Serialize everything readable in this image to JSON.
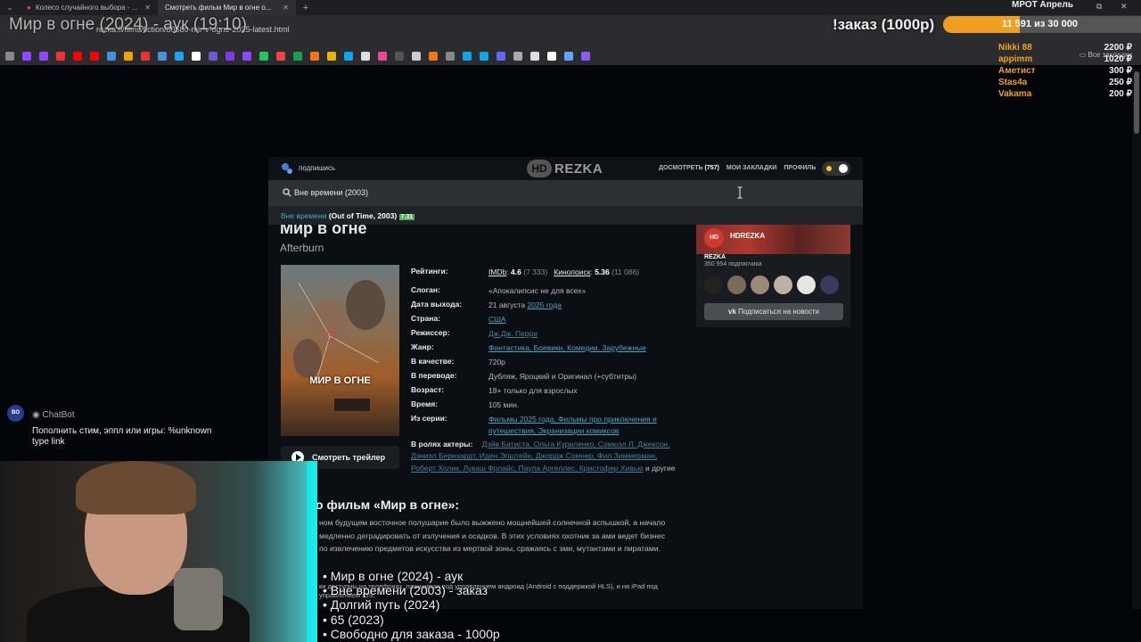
{
  "browser": {
    "tabs": [
      {
        "label": "Колесо случайного выбора - ...",
        "active": false
      },
      {
        "label": "Смотреть фильм Мир в огне о...",
        "active": true
      }
    ],
    "url": "rezka.fi/films/fiction/80680-mir-v-ogne-2025-latest.html",
    "all_bookmarks": "Все закладки"
  },
  "stream_overlay": {
    "title": "Мир в огне (2024) - аук (19:10)",
    "order_banner": "!заказ (1000р)",
    "goal_title": "МРОТ Апрель",
    "goal_progress_text": "11 591  из 30 000",
    "goal_fraction": 0.386,
    "donors": [
      {
        "name": "Nikki 88",
        "amount": "2200 ₽"
      },
      {
        "name": "appimm",
        "amount": "1020 ₽"
      },
      {
        "name": "Аметист",
        "amount": "300 ₽"
      },
      {
        "name": "Stas4a",
        "amount": "250 ₽"
      },
      {
        "name": "Vakama",
        "amount": "200 ₽"
      }
    ],
    "chatbot": {
      "name": "ChatBot",
      "message": "Пополнить стим, эппл или игры:  %unknown type link"
    },
    "queue": [
      "• Мир в огне (2024) - аук",
      "• Вне времени (2003) - заказ",
      "• Долгий путь (2024)",
      "• 65 (2023)",
      "• Свободно для заказа - 1000р"
    ]
  },
  "site": {
    "subscribe_label": "подпишись",
    "logo_hd": "HD",
    "logo_text": "REZKA",
    "nav": {
      "continue": "ДОСМОТРЕТЬ",
      "continue_count": "(757)",
      "bookmarks": "МОИ ЗАКЛАДКИ",
      "profile": "ПРОФИЛЬ"
    },
    "search_value": "Вне времени (2003)",
    "suggestion": {
      "title": "Вне времени",
      "orig": "(Out of Time, 2003)",
      "rating": "7.31"
    }
  },
  "film": {
    "title": "Мир в огне",
    "orig_title": "Afterburn",
    "poster_title": "МИР В ОГНЕ",
    "trailer_label": "Смотреть трейлер",
    "ratings_key": "Рейтинги:",
    "imdb_name": "IMDb",
    "imdb_value": "4.6",
    "imdb_count": "(7 333)",
    "kp_name": "Кинопоиск",
    "kp_value": "5.36",
    "kp_count": "(11 086)",
    "rows": [
      {
        "key": "Слоган:",
        "value": "«Апокалипсис не для всех»"
      },
      {
        "key": "Дата выхода:",
        "value": "21 августа",
        "link": "2025 года"
      },
      {
        "key": "Страна:",
        "link": "США"
      },
      {
        "key": "Режиссер:",
        "link": "Дж.Дж. Перри"
      },
      {
        "key": "Жанр:",
        "link": "Фантастика, Боевики, Комедии, Зарубежные"
      },
      {
        "key": "В качестве:",
        "value": "720p"
      },
      {
        "key": "В переводе:",
        "value": "Дубляж, Ярoцкий и Оригинал (+субтитры)"
      },
      {
        "key": "Возраст:",
        "value": "18+ только для взрослых"
      },
      {
        "key": "Время:",
        "value": "105 мин."
      },
      {
        "key": "Из серии:",
        "link": "Фильмы 2025 года, Фильмы про приключения и путешествия, Экранизации комиксов"
      }
    ],
    "actors_key": "В ролях актеры:",
    "actors": "Дэйв Батиста, Ольга Куриленко, Сэмюэл Л. Джексон, Дэниэл Бернхардт, Иден Эпштейн, Джордж Сомнер, Фил Зиммерман, Роберт Холик, Лукаш Фрлайс, Паула Аргеллес, Кристофер Хивью",
    "actors_tail": "и другие",
    "about_heading": "о фильм «Мир в огне»:",
    "about_text": "ном будущем восточное полушарие было выжжено мощнейшей солнечной вспышкой, а начало медленно деградировать от излучения и осадков. В этих условиях охотник за ами ведет бизнес по извлечению предметов искусства из мертвой зоны, сражаясь с зми, мутантами и пиратами.",
    "about_note": "ки доступны на телефонах, планшетах под управлением андроид (Android с поддержкой HLS), и на iPad под управлением iOS."
  },
  "vk_widget": {
    "logo": "HD REZKA",
    "name": "HDREZKA",
    "subscribers": "350 954 подписчика",
    "button": "Подписаться на новости"
  }
}
